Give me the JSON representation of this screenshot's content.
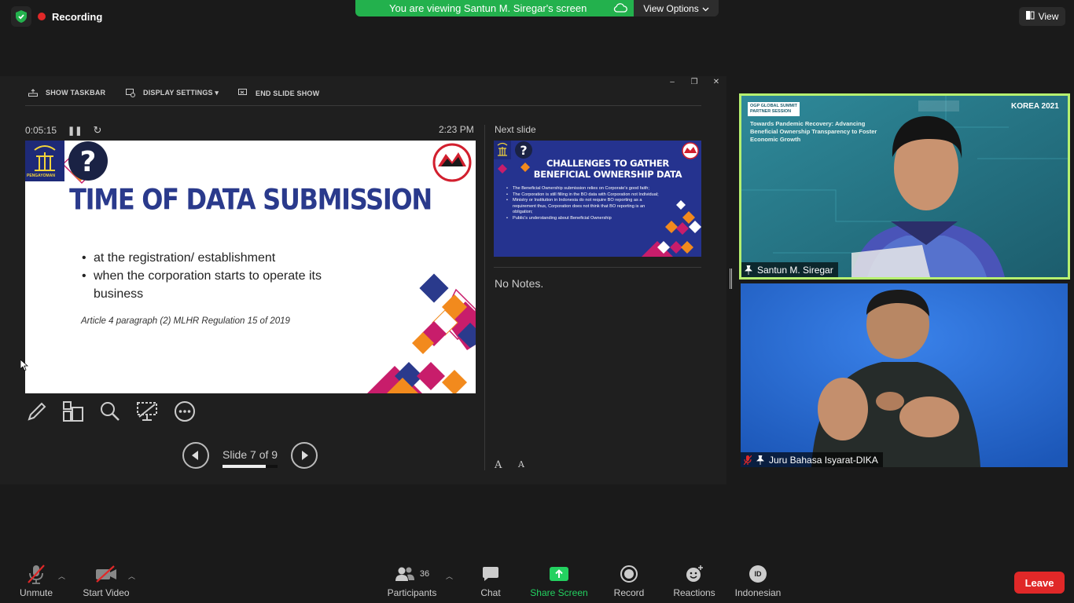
{
  "recording": {
    "label": "Recording"
  },
  "banner": {
    "text": "You are viewing Santun M. Siregar's screen",
    "view_options": "View Options"
  },
  "view_button": {
    "label": "View"
  },
  "presenter": {
    "toolbar": {
      "show_taskbar": "SHOW TASKBAR",
      "display_settings": "DISPLAY SETTINGS ▾",
      "end_slide_show": "END SLIDE SHOW"
    },
    "window": {
      "minimize": "–",
      "restore": "❐",
      "close": "✕"
    },
    "timer": "0:05:15",
    "clock": "2:23 PM",
    "next_slide_label": "Next slide",
    "notes": "No Notes.",
    "slide_counter": "Slide 7 of 9",
    "slide_progress": 0.78,
    "font_increase": "A",
    "font_decrease": "A"
  },
  "current_slide": {
    "title": "TIME OF DATA SUBMISSION",
    "bullets": [
      "at the registration/ establishment",
      "when the corporation starts to operate its business"
    ],
    "reference": "Article 4 paragraph (2) MLHR Regulation 15 of 2019",
    "logo_text": "PENGAYOMAN"
  },
  "next_slide": {
    "title": "CHALLENGES TO GATHER BENEFICIAL OWNERSHIP DATA",
    "bullets": [
      "The Beneficial Ownership submission relies on Corporate's good faith;",
      "The Corporation is still filling in the BO data with Corporation not Individual;",
      "Ministry or Institution in Indonesia do not require BO reporting as a requirement thus, Corporation does not think that BO reporting is an obligation;",
      "Public's understanding about Beneficial Ownership"
    ]
  },
  "participants_video": [
    {
      "name": "Santun M. Siregar",
      "banner_line1": "OGP GLOBAL SUMMIT",
      "banner_line2": "PARTNER SESSION",
      "headline": "Towards Pandemic Recovery: Advancing Beneficial Ownership Transparency to Foster Economic Growth",
      "event": "KOREA 2021"
    },
    {
      "name": "Juru Bahasa Isyarat-DIKA"
    }
  ],
  "bottom_bar": {
    "unmute": "Unmute",
    "start_video": "Start Video",
    "participants": "Participants",
    "participant_count": "36",
    "chat": "Chat",
    "share_screen": "Share Screen",
    "record": "Record",
    "reactions": "Reactions",
    "language": "Indonesian",
    "language_code": "ID",
    "leave": "Leave"
  },
  "colors": {
    "banner_green": "#23b14d",
    "leave_red": "#e02828",
    "slide_title_blue": "#2a3a8c",
    "active_speaker": "#b6f070"
  }
}
